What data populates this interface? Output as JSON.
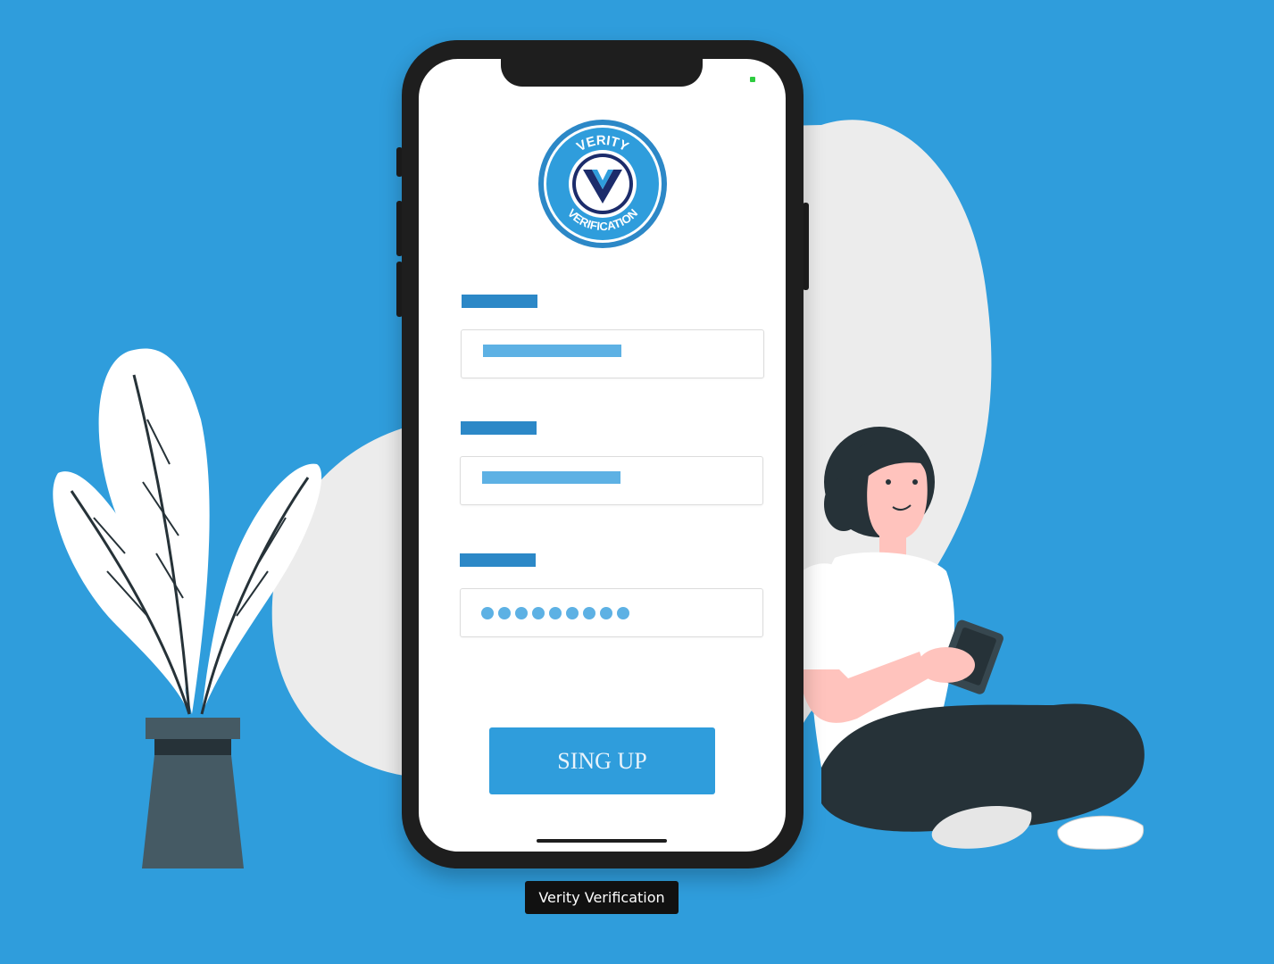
{
  "app": {
    "logo": {
      "top_text": "VERITY",
      "bottom_text": "VERIFICATION",
      "monogram": "V"
    },
    "form": {
      "fields": [
        {
          "type": "text",
          "value_masked": true
        },
        {
          "type": "text",
          "value_masked": true
        },
        {
          "type": "password",
          "dot_count": 9
        }
      ],
      "submit_label": "SING UP"
    },
    "caption": "Verity Verification"
  },
  "colors": {
    "background": "#2f9ddc",
    "accent": "#2c88c7",
    "field_fill": "#5db1e4",
    "phone_frame": "#1e1e1e"
  },
  "icons": [
    "verity-logo-icon",
    "status-indicator-icon",
    "plant-illustration",
    "woman-with-phone-illustration"
  ]
}
